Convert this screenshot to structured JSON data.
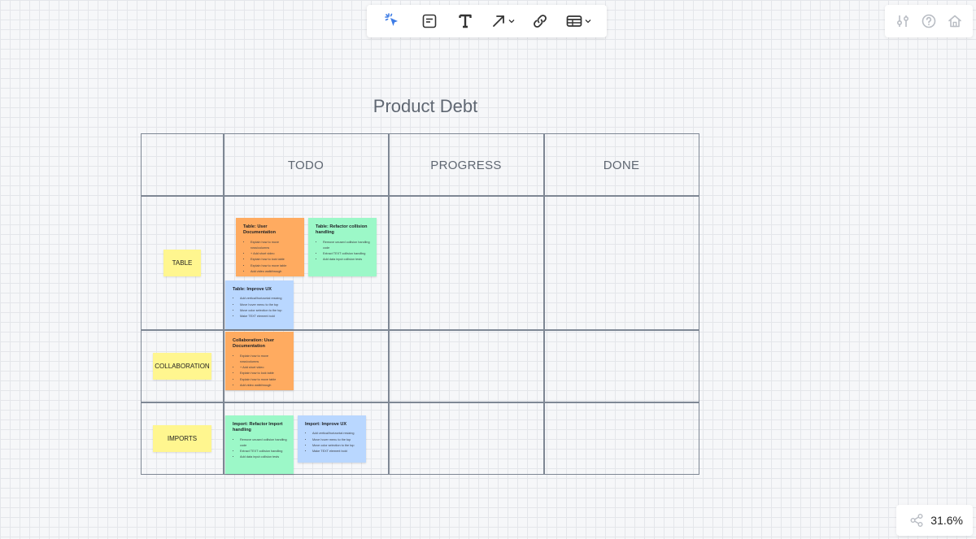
{
  "toolbar": {
    "tools": [
      {
        "name": "select-tool",
        "icon": "cursor-click-icon"
      },
      {
        "name": "sticky-note-tool",
        "icon": "note-icon"
      },
      {
        "name": "text-tool",
        "icon": "text-t-icon"
      },
      {
        "name": "connector-tool",
        "icon": "arrow-icon"
      },
      {
        "name": "link-tool",
        "icon": "link-icon"
      },
      {
        "name": "table-tool",
        "icon": "table-icon"
      }
    ],
    "accent": "#3d7ce6"
  },
  "right_toolbar": {
    "icons": [
      "settings-sliders-icon",
      "help-icon",
      "home-icon"
    ]
  },
  "zoom": {
    "level": "31.6%"
  },
  "board": {
    "title": "Product Debt",
    "columns": [
      "TODO",
      "PROGRESS",
      "DONE"
    ],
    "rows": [
      "TABLE",
      "COLLABORATION",
      "IMPORTS"
    ],
    "colors": {
      "orange": "#ffab60",
      "green": "#9cf8c8",
      "blue": "#b9d7ff",
      "yellow": "#fff68f"
    },
    "cards": [
      {
        "title": "Table: User Documentation",
        "color": "orange",
        "items": [
          "Explain how to move rows/columns",
          "+ Add short video",
          "Explain how to lock table",
          "Explain how to move table",
          "Add video walkthrough"
        ]
      },
      {
        "title": "Table: Refactor collision handling",
        "color": "green",
        "items": [
          "Remove unused collision handling code",
          "Extract TEXT collision handling",
          "Add data input collision tests"
        ]
      },
      {
        "title": "Table: Improve UX",
        "color": "blue",
        "items": [
          "Add vertical/horizontal resizing",
          "Move hover menu to the top",
          "Move color selection to the top",
          "Make TEXT element bold"
        ]
      },
      {
        "title": "Collaboration: User Documentation",
        "color": "orange",
        "items": [
          "Explain how to move rows/columns",
          "+ Add short video",
          "Explain how to lock table",
          "Explain how to move table",
          "Add video walkthrough"
        ]
      },
      {
        "title": "Import: Refactor Import handling",
        "color": "green",
        "items": [
          "Remove unused collision handling code",
          "Extract TEXT collision handling",
          "Add data input collision tests"
        ]
      },
      {
        "title": "Import: Improve UX",
        "color": "blue",
        "items": [
          "Add vertical/horizontal resizing",
          "Move hover menu to the top",
          "Move color selection to the top",
          "Make TEXT element bold"
        ]
      }
    ]
  }
}
